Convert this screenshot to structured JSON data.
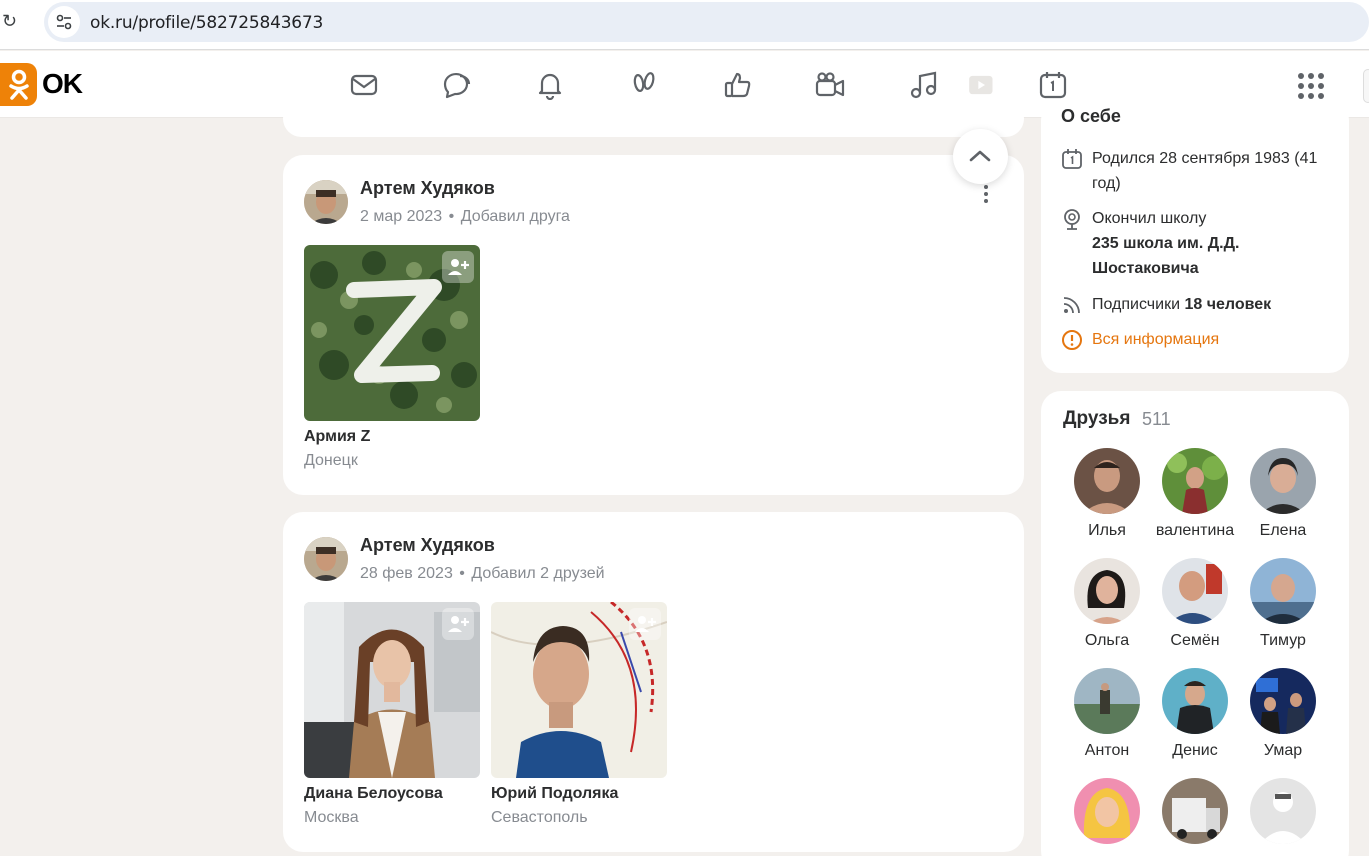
{
  "browser": {
    "url": "ok.ru/profile/582725843673"
  },
  "brand": {
    "logo_text": "OK",
    "accent": "#ee8208"
  },
  "topnav": {
    "icons": [
      "messages-icon",
      "discussions-icon",
      "notifications-icon",
      "guests-icon",
      "reactions-icon",
      "video-icon",
      "music-icon",
      "games-icon",
      "events-icon",
      "apps-grid-icon"
    ]
  },
  "feed": {
    "posts": [
      {
        "author": "Артем Худяков",
        "date": "2 мар 2023",
        "action": "Добавил друга",
        "items": [
          {
            "name": "Армия Z",
            "sub": "Донецк"
          }
        ]
      },
      {
        "author": "Артем Худяков",
        "date": "28 фев 2023",
        "action": "Добавил 2 друзей",
        "items": [
          {
            "name": "Диана Белоусова",
            "sub": "Москва"
          },
          {
            "name": "Юрий Подоляка",
            "sub": "Севастополь"
          }
        ]
      }
    ]
  },
  "about": {
    "heading": "О себе",
    "birth": "Родился 28 сентября 1983 (41 год)",
    "school_label": "Окончил школу",
    "school_name": "235 школа им. Д.Д. Шостаковича",
    "followers_label": "Подписчики",
    "followers_value": "18 человек",
    "all_info": "Вся информация"
  },
  "friends": {
    "title": "Друзья",
    "count": "511",
    "list": [
      {
        "name": "Илья"
      },
      {
        "name": "валентина"
      },
      {
        "name": "Елена"
      },
      {
        "name": "Ольга"
      },
      {
        "name": "Семён"
      },
      {
        "name": "Тимур"
      },
      {
        "name": "Антон"
      },
      {
        "name": "Денис"
      },
      {
        "name": "Умар"
      }
    ]
  }
}
